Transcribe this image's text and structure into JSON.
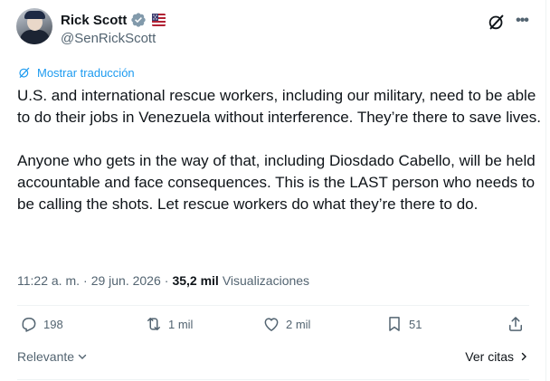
{
  "author": {
    "name": "Rick Scott",
    "handle": "@SenRickScott"
  },
  "translate_label": "Mostrar traducción",
  "tweet": {
    "text": "U.S. and international rescue workers, including our military, need to be able to do their jobs in Venezuela without interference. They’re there to save lives.\n\nAnyone who gets in the way of that, including Diosdado Cabello, will be held accountable and face consequences. This is the LAST person who needs to be calling the shots. Let rescue workers do what they’re there to do."
  },
  "meta": {
    "time": "11:22 a. m.",
    "separator1": "·",
    "date": "29 jun. 2026",
    "separator2": "·",
    "views_count": "35,2 mil",
    "views_label": "Visualizaciones"
  },
  "actions": {
    "replies": "198",
    "reposts": "1 mil",
    "likes": "2 mil",
    "bookmarks": "51"
  },
  "footer": {
    "sort_label": "Relevante",
    "quotes_label": "Ver citas"
  },
  "colors": {
    "accent": "#1d9bf0",
    "verified_badge": "#829aab",
    "secondary_text": "#536471"
  },
  "icons": {
    "verified": "verified-badge-icon",
    "flag": "us-flag-icon",
    "grok": "grok-icon",
    "more": "more-icon",
    "translate": "translate-icon",
    "reply": "reply-icon",
    "repost": "repost-icon",
    "like": "heart-icon",
    "bookmark": "bookmark-icon",
    "share": "share-icon",
    "chevron_down": "chevron-down-icon",
    "chevron_right": "chevron-right-icon"
  }
}
